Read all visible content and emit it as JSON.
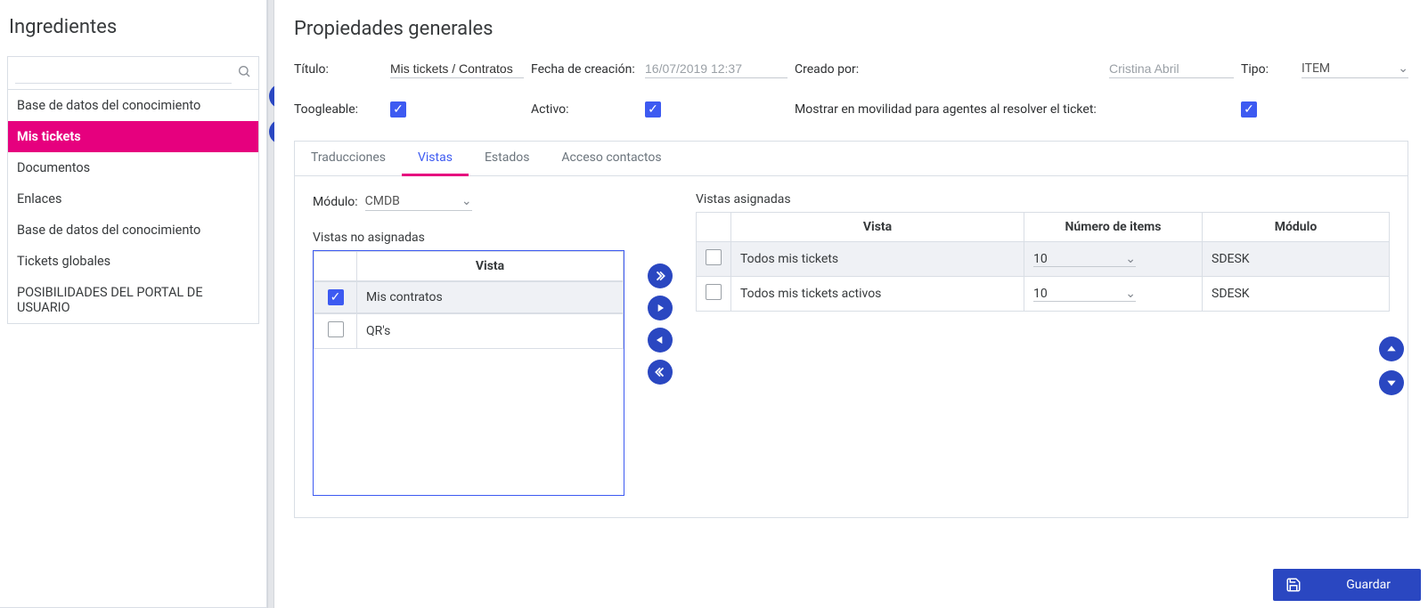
{
  "sidebar": {
    "title": "Ingredientes",
    "search_placeholder": "",
    "items": [
      {
        "label": "Base de datos del conocimiento",
        "active": false
      },
      {
        "label": "Mis tickets",
        "active": true
      },
      {
        "label": "Documentos",
        "active": false
      },
      {
        "label": "Enlaces",
        "active": false
      },
      {
        "label": "Base de datos del conocimiento",
        "active": false
      },
      {
        "label": "Tickets globales",
        "active": false
      },
      {
        "label": "POSIBILIDADES DEL PORTAL DE USUARIO",
        "active": false
      }
    ]
  },
  "main": {
    "title": "Propiedades generales",
    "labels": {
      "titulo": "Título:",
      "fecha": "Fecha de creación:",
      "creado": "Creado por:",
      "tipo": "Tipo:",
      "toogleable": "Toogleable:",
      "activo": "Activo:",
      "mostrar": "Mostrar en movilidad para agentes al resolver el ticket:"
    },
    "values": {
      "titulo": "Mis tickets / Contratos",
      "fecha": "16/07/2019 12:37",
      "creado": "Cristina Abril",
      "tipo": "ITEM"
    },
    "checks": {
      "toogleable": true,
      "activo": true,
      "mostrar": true
    }
  },
  "tabs": {
    "items": [
      "Traducciones",
      "Vistas",
      "Estados",
      "Acceso contactos"
    ],
    "active": "Vistas"
  },
  "vistas": {
    "modulo_label": "Módulo:",
    "modulo_value": "CMDB",
    "unassigned_title": "Vistas no asignadas",
    "unassigned_header": "Vista",
    "unassigned": [
      {
        "name": "Mis contratos",
        "checked": true
      },
      {
        "name": "QR's",
        "checked": false
      }
    ],
    "assigned_title": "Vistas asignadas",
    "assigned_headers": {
      "vista": "Vista",
      "num": "Número de items",
      "mod": "Módulo"
    },
    "assigned": [
      {
        "name": "Todos mis tickets",
        "num": "10",
        "mod": "SDESK",
        "checked": false
      },
      {
        "name": "Todos mis tickets activos",
        "num": "10",
        "mod": "SDESK",
        "checked": false
      }
    ]
  },
  "save_label": "Guardar"
}
